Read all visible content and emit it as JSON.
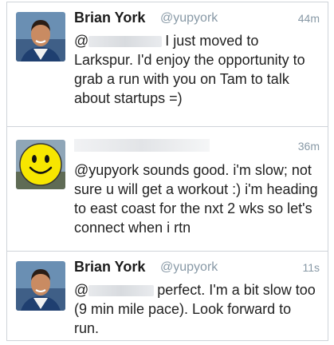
{
  "tweets": [
    {
      "name": "Brian York",
      "handle": "@yupyork",
      "time": "44m",
      "mention_prefix": "@",
      "text": "I just moved to Larkspur. I'd enjoy the opportunity to grab a run with you on Tam to talk about startups =)",
      "avatar": "profile-photo"
    },
    {
      "name": "",
      "handle": "",
      "time": "36m",
      "text": "@yupyork sounds good.  i'm slow; not sure u will get a workout :)  i'm heading to east coast for the nxt 2 wks so let's connect when i rtn",
      "avatar": "smiley-face"
    },
    {
      "name": "Brian York",
      "handle": "@yupyork",
      "time": "11s",
      "mention_prefix": "@",
      "text": "perfect. I'm a bit slow too (9 min mile pace). Look forward to run.",
      "avatar": "profile-photo"
    }
  ],
  "colors": {
    "name": "#1c1c1c",
    "meta": "#8899a6",
    "border": "#cfd4d9",
    "smiley": "#f7e600"
  }
}
